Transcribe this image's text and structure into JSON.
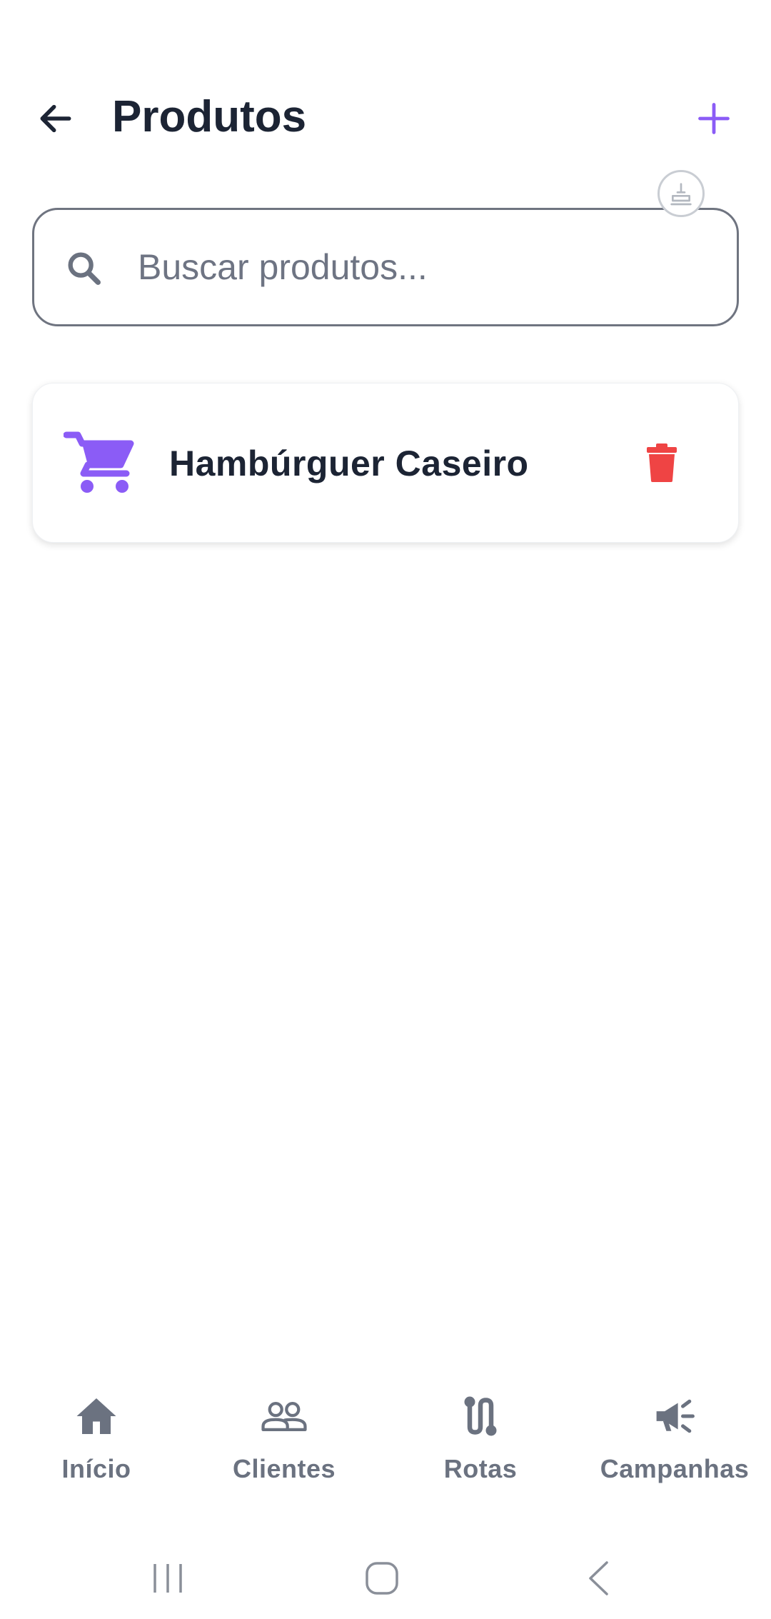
{
  "header": {
    "title": "Produtos",
    "back_icon": "arrow-left-icon",
    "add_icon": "plus-icon"
  },
  "floating_button": {
    "icon": "stamp-icon"
  },
  "search": {
    "placeholder": "Buscar produtos...",
    "value": "",
    "icon": "search-icon"
  },
  "products": [
    {
      "name": "Hambúrguer Caseiro",
      "icon": "cart-icon",
      "action_icon": "trash-icon"
    }
  ],
  "bottom_nav": {
    "items": [
      {
        "label": "Início",
        "icon": "home-icon"
      },
      {
        "label": "Clientes",
        "icon": "users-icon"
      },
      {
        "label": "Rotas",
        "icon": "route-icon"
      },
      {
        "label": "Campanhas",
        "icon": "megaphone-icon"
      }
    ]
  },
  "system_nav": {
    "icons": [
      "recent-apps-icon",
      "home-circle-icon",
      "back-chevron-icon"
    ]
  },
  "colors": {
    "accent": "#8b5cf6",
    "danger": "#ef4444",
    "text_dark": "#1c2434",
    "text_muted": "#6b7280"
  }
}
